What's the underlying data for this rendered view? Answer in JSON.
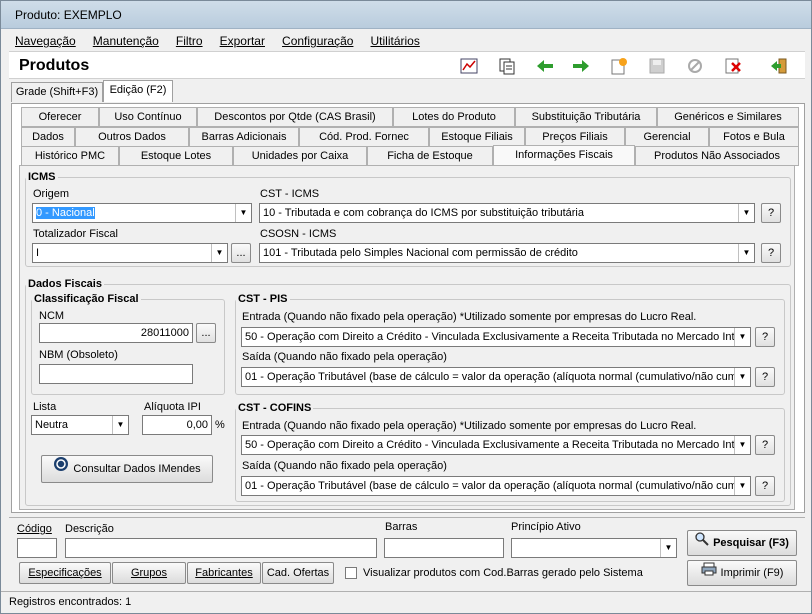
{
  "window": {
    "title": "Produto: EXEMPLO"
  },
  "menu": [
    "Navegação",
    "Manutenção",
    "Filtro",
    "Exportar",
    "Configuração",
    "Utilitários"
  ],
  "header": {
    "title": "Produtos"
  },
  "mode_tabs": [
    "Grade (Shift+F3)",
    "Edição (F2)"
  ],
  "tabs_row1": [
    "Oferecer",
    "Uso Contínuo",
    "Descontos por Qtde (CAS Brasil)",
    "Lotes do Produto",
    "Substituição Tributária",
    "Genéricos e Similares"
  ],
  "tabs_row2": [
    "Dados",
    "Outros Dados",
    "Barras Adicionais",
    "Cód. Prod. Fornec",
    "Estoque Filiais",
    "Preços Filiais",
    "Gerencial",
    "Fotos e Bula"
  ],
  "tabs_row3": [
    "Histórico PMC",
    "Estoque Lotes",
    "Unidades por Caixa",
    "Ficha de Estoque",
    "Informações Fiscais",
    "Produtos Não Associados"
  ],
  "icms": {
    "legend": "ICMS",
    "origem_label": "Origem",
    "origem_value": "0 - Nacional",
    "cst_label": "CST - ICMS",
    "cst_value": "10 - Tributada e com cobrança do ICMS por substituição tributária",
    "totalizador_label": "Totalizador Fiscal",
    "totalizador_value": "I",
    "csosn_label": "CSOSN - ICMS",
    "csosn_value": "101 - Tributada pelo Simples Nacional com permissão de crédito"
  },
  "dados_fiscais": {
    "legend": "Dados Fiscais",
    "classificacao_legend": "Classificação Fiscal",
    "ncm_label": "NCM",
    "ncm_value": "28011000",
    "nbm_label": "NBM (Obsoleto)",
    "nbm_value": "",
    "lista_label": "Lista",
    "lista_value": "Neutra",
    "aliquota_label": "Alíquota IPI",
    "aliquota_value": "0,00",
    "percent": "%",
    "consultar_label": "Consultar Dados IMendes"
  },
  "cst_pis": {
    "legend": "CST - PIS",
    "entrada_label": "Entrada (Quando não fixado pela operação) *Utilizado somente por empresas do Lucro Real.",
    "entrada_value": "50 - Operação com Direito a Crédito - Vinculada Exclusivamente a Receita Tributada no Mercado Inter",
    "saida_label": "Saída (Quando não fixado pela operação)",
    "saida_value": "01 - Operação Tributável (base de cálculo = valor da operação (alíquota normal (cumulativo/não cumu"
  },
  "cst_cofins": {
    "legend": "CST - COFINS",
    "entrada_label": "Entrada (Quando não fixado pela operação) *Utilizado somente por empresas do Lucro Real.",
    "entrada_value": "50 - Operação com Direito a Crédito - Vinculada Exclusivamente a Receita Tributada no Mercado Inter",
    "saida_label": "Saída (Quando não fixado pela operação)",
    "saida_value": "01 - Operação Tributável (base de cálculo = valor da operação (alíquota normal (cumulativo/não cumu"
  },
  "search": {
    "codigo_label": "Código",
    "descricao_label": "Descrição",
    "barras_label": "Barras",
    "principio_label": "Princípio Ativo",
    "pesquisar_label": "Pesquisar (F3)",
    "imprimir_label": "Imprimir (F9)",
    "especificacoes_label": "Especificações",
    "grupos_label": "Grupos",
    "fabricantes_label": "Fabricantes",
    "ofertas_label": "Cad. Ofertas",
    "visualizar_label": "Visualizar produtos com Cod.Barras gerado pelo Sistema"
  },
  "status": {
    "text": "Registros encontrados: 1"
  },
  "help": "?",
  "ellipsis": "...",
  "icons": [
    "chart-icon",
    "copy-icon",
    "arrow-left-icon",
    "arrow-right-icon",
    "new-icon",
    "save-icon",
    "cancel-icon",
    "delete-icon",
    "exit-icon",
    "search-icon",
    "printer-icon",
    "imendes-icon"
  ]
}
